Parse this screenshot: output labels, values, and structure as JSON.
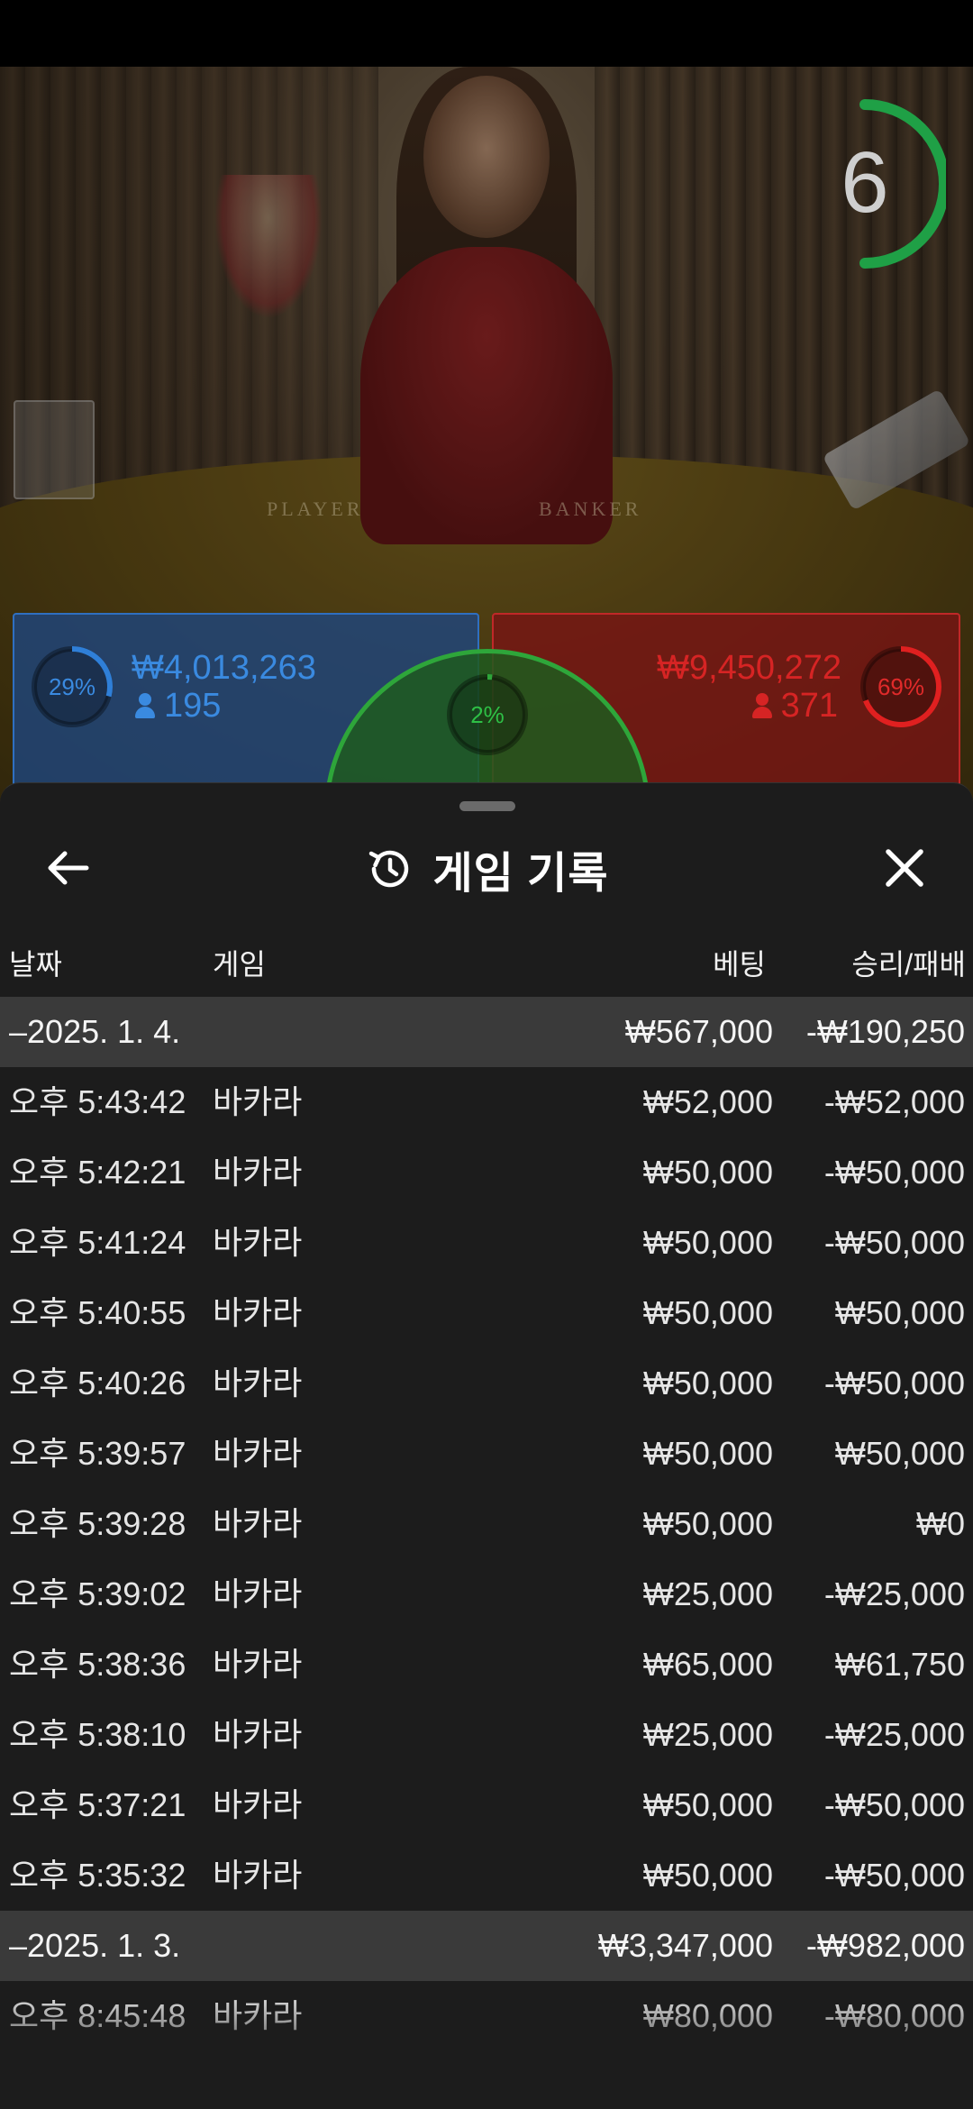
{
  "game": {
    "timer": "6",
    "table_labels": {
      "player": "PLAYER",
      "banker": "BANKER"
    },
    "player": {
      "percent_label": "29%",
      "percent": 29,
      "amount": "₩4,013,263",
      "bettors": "195",
      "color": "#2f7fd8"
    },
    "banker": {
      "percent_label": "69%",
      "percent": 69,
      "amount": "₩9,450,272",
      "bettors": "371",
      "color": "#d02020"
    },
    "tie": {
      "percent_label": "2%",
      "percent": 2,
      "color": "#2ea63a"
    }
  },
  "sheet": {
    "title": "게임 기록",
    "back_icon": "arrow-left-icon",
    "close_icon": "close-icon",
    "history_icon": "history-icon",
    "columns": {
      "date": "날짜",
      "game": "게임",
      "bet": "베팅",
      "result": "승리/패배"
    },
    "groups": [
      {
        "date": "–2025. 1. 4.",
        "total_bet": "₩567,000",
        "total_result": "-₩190,250",
        "rows": [
          {
            "time": "오후 5:43:42",
            "game": "바카라",
            "bet": "₩52,000",
            "result": "-₩52,000"
          },
          {
            "time": "오후 5:42:21",
            "game": "바카라",
            "bet": "₩50,000",
            "result": "-₩50,000"
          },
          {
            "time": "오후 5:41:24",
            "game": "바카라",
            "bet": "₩50,000",
            "result": "-₩50,000"
          },
          {
            "time": "오후 5:40:55",
            "game": "바카라",
            "bet": "₩50,000",
            "result": "₩50,000"
          },
          {
            "time": "오후 5:40:26",
            "game": "바카라",
            "bet": "₩50,000",
            "result": "-₩50,000"
          },
          {
            "time": "오후 5:39:57",
            "game": "바카라",
            "bet": "₩50,000",
            "result": "₩50,000"
          },
          {
            "time": "오후 5:39:28",
            "game": "바카라",
            "bet": "₩50,000",
            "result": "₩0"
          },
          {
            "time": "오후 5:39:02",
            "game": "바카라",
            "bet": "₩25,000",
            "result": "-₩25,000"
          },
          {
            "time": "오후 5:38:36",
            "game": "바카라",
            "bet": "₩65,000",
            "result": "₩61,750"
          },
          {
            "time": "오후 5:38:10",
            "game": "바카라",
            "bet": "₩25,000",
            "result": "-₩25,000"
          },
          {
            "time": "오후 5:37:21",
            "game": "바카라",
            "bet": "₩50,000",
            "result": "-₩50,000"
          },
          {
            "time": "오후 5:35:32",
            "game": "바카라",
            "bet": "₩50,000",
            "result": "-₩50,000"
          }
        ]
      },
      {
        "date": "–2025. 1. 3.",
        "total_bet": "₩3,347,000",
        "total_result": "-₩982,000",
        "rows": [
          {
            "time": "오후 8:45:48",
            "game": "바카라",
            "bet": "₩80,000",
            "result": "-₩80,000"
          }
        ]
      }
    ]
  }
}
